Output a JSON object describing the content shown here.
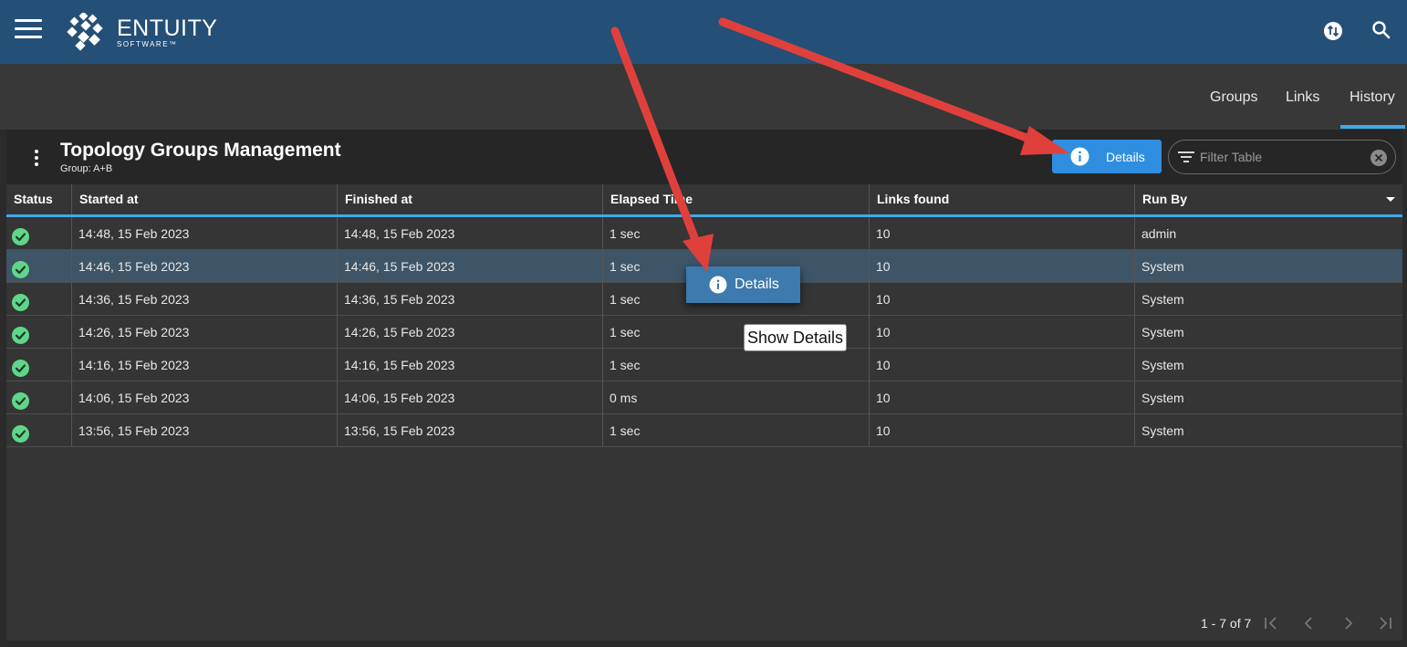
{
  "header": {
    "logo_text": "ENTUITY",
    "logo_subtext": "SOFTWARE™",
    "icons": [
      "hamburger-menu-icon",
      "swap-icon",
      "search-icon"
    ]
  },
  "tabs": [
    {
      "label": "Groups",
      "active": false
    },
    {
      "label": "Links",
      "active": false
    },
    {
      "label": "History",
      "active": true
    }
  ],
  "panel": {
    "title": "Topology Groups Management",
    "subtitle": "Group: A+B",
    "details_button": "Details",
    "filter_placeholder": "Filter Table"
  },
  "table": {
    "columns": [
      "Status",
      "Started at",
      "Finished at",
      "Elapsed Time",
      "Links found",
      "Run By"
    ],
    "rows": [
      {
        "status": "success",
        "started": "14:48, 15 Feb 2023",
        "finished": "14:48, 15 Feb 2023",
        "elapsed": "1 sec",
        "links": "10",
        "run_by": "admin",
        "selected": false
      },
      {
        "status": "success",
        "started": "14:46, 15 Feb 2023",
        "finished": "14:46, 15 Feb 2023",
        "elapsed": "1 sec",
        "links": "10",
        "run_by": "System",
        "selected": true
      },
      {
        "status": "success",
        "started": "14:36, 15 Feb 2023",
        "finished": "14:36, 15 Feb 2023",
        "elapsed": "1 sec",
        "links": "10",
        "run_by": "System",
        "selected": false
      },
      {
        "status": "success",
        "started": "14:26, 15 Feb 2023",
        "finished": "14:26, 15 Feb 2023",
        "elapsed": "1 sec",
        "links": "10",
        "run_by": "System",
        "selected": false
      },
      {
        "status": "success",
        "started": "14:16, 15 Feb 2023",
        "finished": "14:16, 15 Feb 2023",
        "elapsed": "1 sec",
        "links": "10",
        "run_by": "System",
        "selected": false
      },
      {
        "status": "success",
        "started": "14:06, 15 Feb 2023",
        "finished": "14:06, 15 Feb 2023",
        "elapsed": "0 ms",
        "links": "10",
        "run_by": "System",
        "selected": false
      },
      {
        "status": "success",
        "started": "13:56, 15 Feb 2023",
        "finished": "13:56, 15 Feb 2023",
        "elapsed": "1 sec",
        "links": "10",
        "run_by": "System",
        "selected": false
      }
    ]
  },
  "context_menu": {
    "details_label": "Details",
    "tooltip": "Show Details"
  },
  "pagination": {
    "range_text": "1 - 7 of 7"
  },
  "colors": {
    "header_bg": "#244f77",
    "accent": "#3fa9e8",
    "button_blue": "#2f8ee0",
    "status_success": "#5fd68a",
    "annotation_arrow": "#e0403c"
  }
}
